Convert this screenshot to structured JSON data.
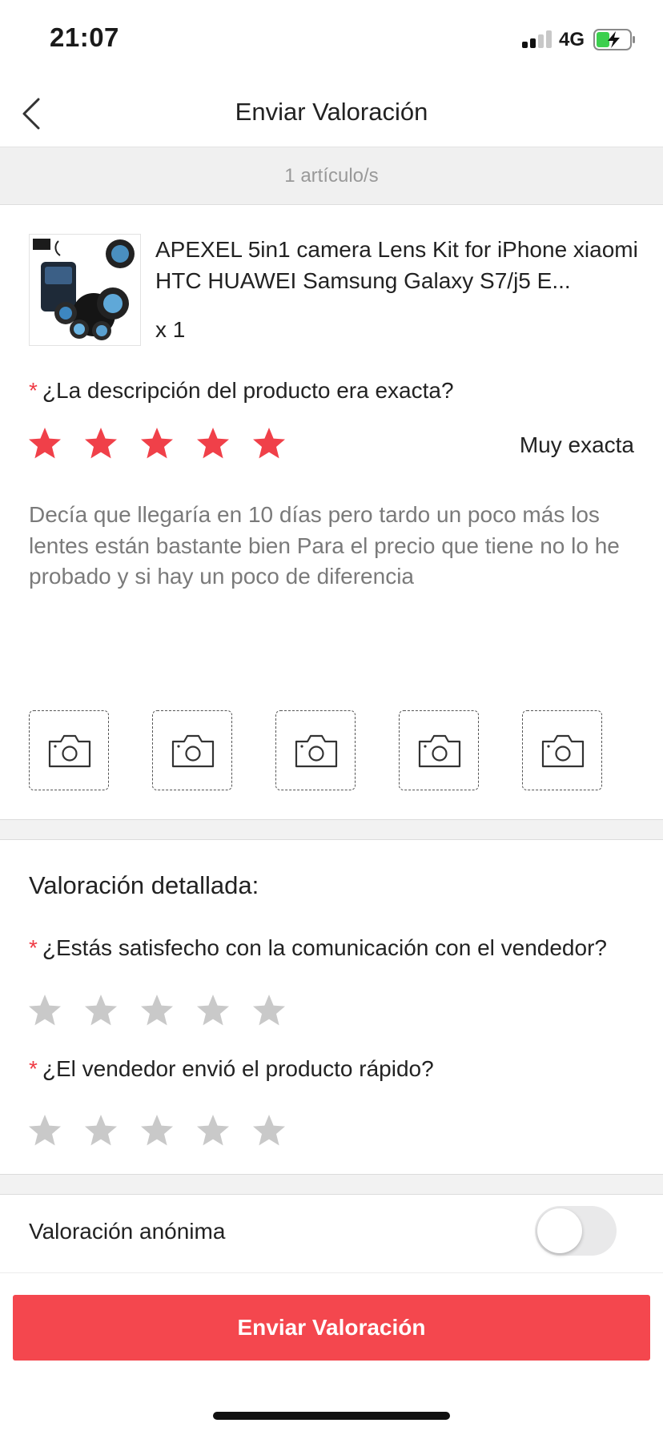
{
  "status_bar": {
    "time": "21:07",
    "network": "4G",
    "signal_bars_active": 2,
    "signal_bars_total": 4,
    "battery_charging": true
  },
  "nav": {
    "back_icon": "chevron-left-icon",
    "title": "Enviar Valoración"
  },
  "items_count": "1 artículo/s",
  "product": {
    "title": "APEXEL 5in1 camera Lens Kit for iPhone xiaomi HTC HUAWEI Samsung Galaxy S7/j5 E...",
    "quantity": "x 1",
    "image_icon": "camera-lens-kit-product-image"
  },
  "description_question": {
    "required_mark": "*",
    "text": "¿La descripción del producto era exacta?",
    "rating": 5,
    "max_rating": 5,
    "rating_label": "Muy exacta"
  },
  "review_text": "Decía que llegaría en 10 días pero tardo un poco más los lentes están bastante bien Para el precio que tiene no lo he probado y si hay un poco de diferencia",
  "photo_slots": {
    "count": 5,
    "icon": "camera-icon"
  },
  "detailed": {
    "title": "Valoración detallada:",
    "questions": [
      {
        "required_mark": "*",
        "text": "¿Estás satisfecho con la comunicación con el vendedor?",
        "rating": 0,
        "max_rating": 5
      },
      {
        "required_mark": "*",
        "text": "¿El vendedor envió el producto rápido?",
        "rating": 0,
        "max_rating": 5
      }
    ]
  },
  "anonymous": {
    "label": "Valoración anónima",
    "enabled": false
  },
  "submit_label": "Enviar Valoración",
  "colors": {
    "accent": "#f4474e",
    "star_active": "#f04049",
    "star_inactive": "#c9c9c9",
    "required_mark": "#ef3b45",
    "review_text": "#7a7a7a"
  }
}
